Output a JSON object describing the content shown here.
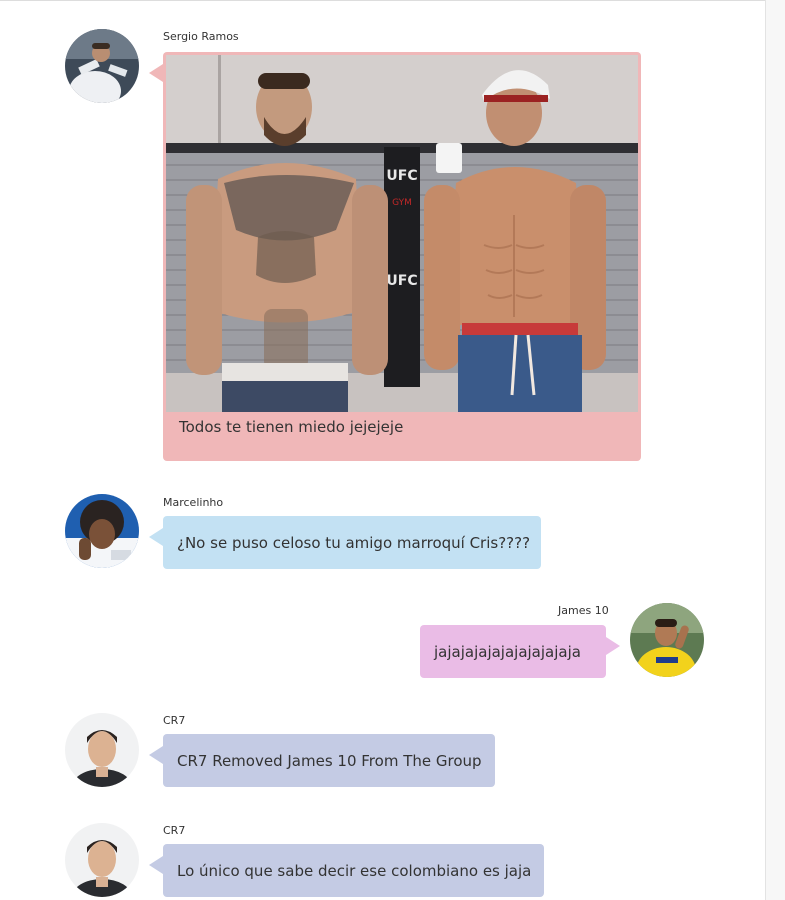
{
  "messages": [
    {
      "sender": "Sergio Ramos",
      "side": "left",
      "type": "image",
      "caption": "Todos te tienen miedo jejejeje",
      "image_sign_text": "UFC GYM UFC",
      "bubble_color": "#f0b7b8"
    },
    {
      "sender": "Marcelinho",
      "side": "left",
      "type": "text",
      "text": "¿No se puso celoso tu amigo marroquí Cris????",
      "bubble_color": "#c3e1f3"
    },
    {
      "sender": "James 10",
      "side": "right",
      "type": "text",
      "text": "jajajajajajajajajajaja",
      "bubble_color": "#eabce6"
    },
    {
      "sender": "CR7",
      "side": "left",
      "type": "text",
      "text": "CR7 Removed James 10 From The Group",
      "bubble_color": "#c4cbe4"
    },
    {
      "sender": "CR7",
      "side": "left",
      "type": "text",
      "text": "Lo único que sabe decir ese colombiano es jaja",
      "bubble_color": "#c4cbe4"
    }
  ]
}
